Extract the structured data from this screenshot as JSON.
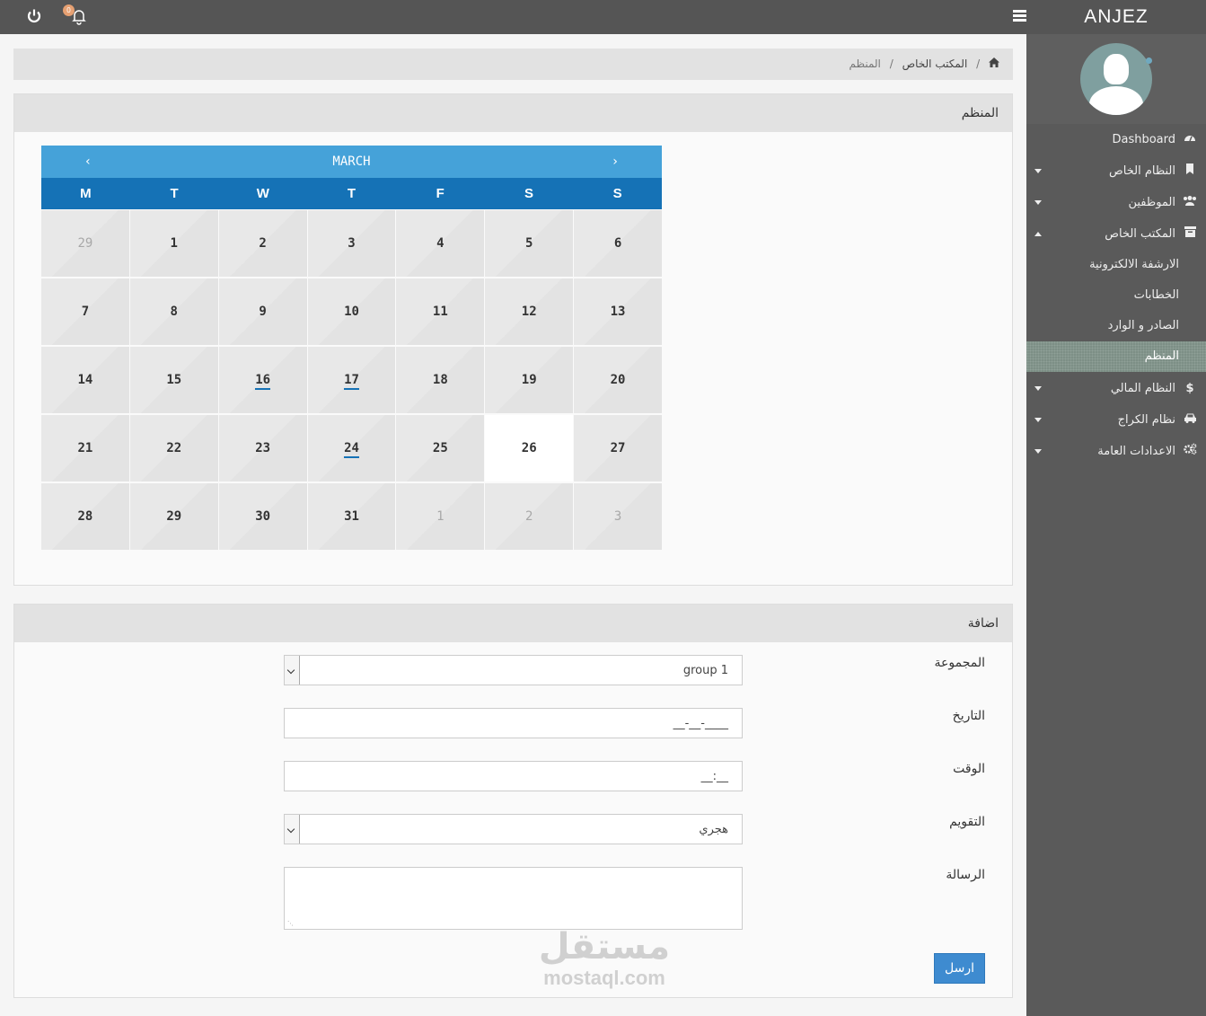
{
  "app": {
    "brand": "ANJEZ",
    "notification_count": "0"
  },
  "icons": {
    "power": "power-icon",
    "bell": "bell-icon",
    "menu": "hamburger-icon",
    "home": "home-icon"
  },
  "sidebar": {
    "items": [
      {
        "label": "Dashboard",
        "icon": "dashboard-icon",
        "caret": false
      },
      {
        "label": "النظام الخاص",
        "icon": "bookmark-icon",
        "caret": "down"
      },
      {
        "label": "الموظفين",
        "icon": "users-icon",
        "caret": "down"
      },
      {
        "label": "المكتب الخاص",
        "icon": "archive-icon",
        "caret": "up"
      }
    ],
    "subitems": [
      {
        "label": "الارشفة الالكترونية"
      },
      {
        "label": "الخطابات"
      },
      {
        "label": "الصادر و الوارد"
      },
      {
        "label": "المنظم",
        "active": true
      }
    ],
    "items_after": [
      {
        "label": "النظام المالي",
        "icon": "dollar-icon",
        "caret": "down"
      },
      {
        "label": "نظام الكراج",
        "icon": "car-icon",
        "caret": "down"
      },
      {
        "label": "الاعدادات العامة",
        "icon": "cogs-icon",
        "caret": "down"
      }
    ]
  },
  "breadcrumb": {
    "level1": "المكتب الخاص",
    "current": "المنظم"
  },
  "calendar_panel": {
    "title": "المنظم"
  },
  "calendar": {
    "month": "MARCH",
    "prev": "‹",
    "next": "›",
    "weekdays": [
      "M",
      "T",
      "W",
      "T",
      "F",
      "S",
      "S"
    ],
    "weeks": [
      [
        {
          "d": "29",
          "muted": true
        },
        {
          "d": "1"
        },
        {
          "d": "2"
        },
        {
          "d": "3"
        },
        {
          "d": "4"
        },
        {
          "d": "5"
        },
        {
          "d": "6"
        }
      ],
      [
        {
          "d": "7"
        },
        {
          "d": "8"
        },
        {
          "d": "9"
        },
        {
          "d": "10"
        },
        {
          "d": "11"
        },
        {
          "d": "12"
        },
        {
          "d": "13"
        }
      ],
      [
        {
          "d": "14"
        },
        {
          "d": "15"
        },
        {
          "d": "16",
          "event": true
        },
        {
          "d": "17",
          "event": true
        },
        {
          "d": "18"
        },
        {
          "d": "19"
        },
        {
          "d": "20"
        }
      ],
      [
        {
          "d": "21"
        },
        {
          "d": "22"
        },
        {
          "d": "23"
        },
        {
          "d": "24",
          "event": true
        },
        {
          "d": "25"
        },
        {
          "d": "26",
          "today": true
        },
        {
          "d": "27"
        }
      ],
      [
        {
          "d": "28"
        },
        {
          "d": "29"
        },
        {
          "d": "30"
        },
        {
          "d": "31"
        },
        {
          "d": "1",
          "muted": true
        },
        {
          "d": "2",
          "muted": true
        },
        {
          "d": "3",
          "muted": true
        }
      ]
    ]
  },
  "form_panel": {
    "title": "اضافة",
    "group_label": "المجموعة",
    "group_value": "group 1",
    "date_label": "التاريخ",
    "date_value": "____-__-__",
    "time_label": "الوقت",
    "time_value": "__:__",
    "calendar_type_label": "التقويم",
    "calendar_type_value": "هجري",
    "message_label": "الرسالة",
    "message_value": "",
    "submit_label": "ارسل"
  },
  "watermark": {
    "arabic": "مستقل",
    "latin": "mostaql.com"
  }
}
